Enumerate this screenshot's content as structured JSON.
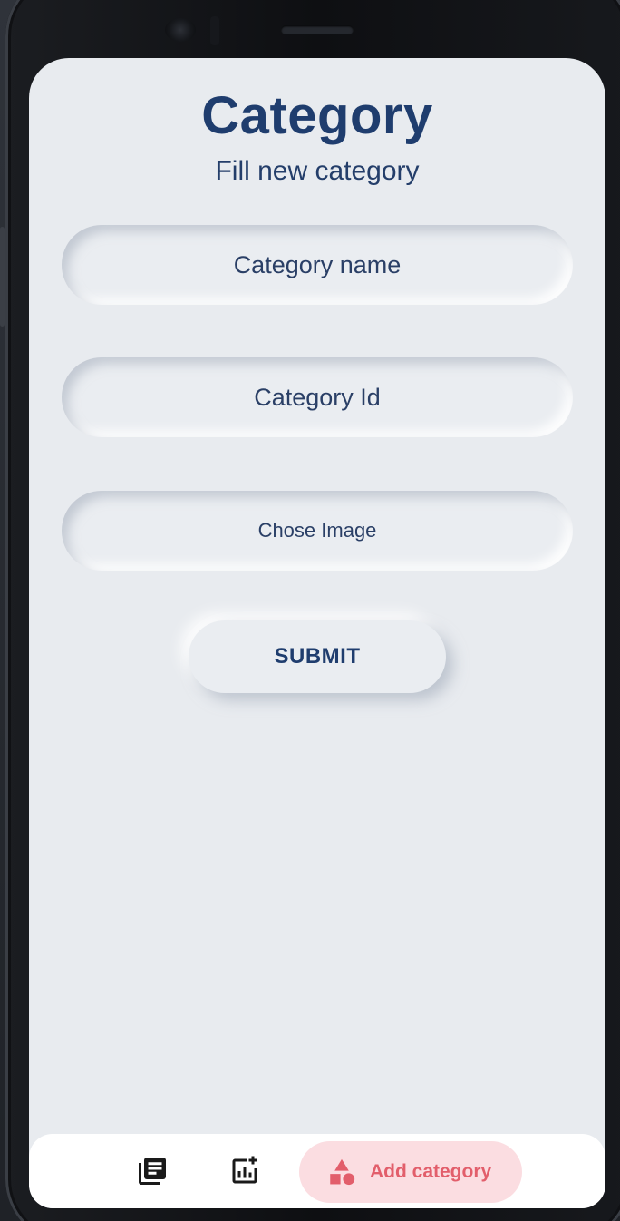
{
  "header": {
    "title": "Category",
    "subtitle": "Fill new category"
  },
  "form": {
    "category_name_placeholder": "Category name",
    "category_id_placeholder": "Category Id",
    "choose_image_label": "Chose Image",
    "submit_label": "SUBMIT"
  },
  "bottom_nav": {
    "items": [
      {
        "icon": "library-books-icon"
      },
      {
        "icon": "add-chart-icon"
      },
      {
        "icon": "category-shapes-icon",
        "label": "Add category",
        "active": true
      }
    ]
  },
  "colors": {
    "primary_text": "#1f3d6e",
    "background": "#e8ebef",
    "active_accent": "#e25e6b",
    "active_pill": "#fbdde1"
  }
}
